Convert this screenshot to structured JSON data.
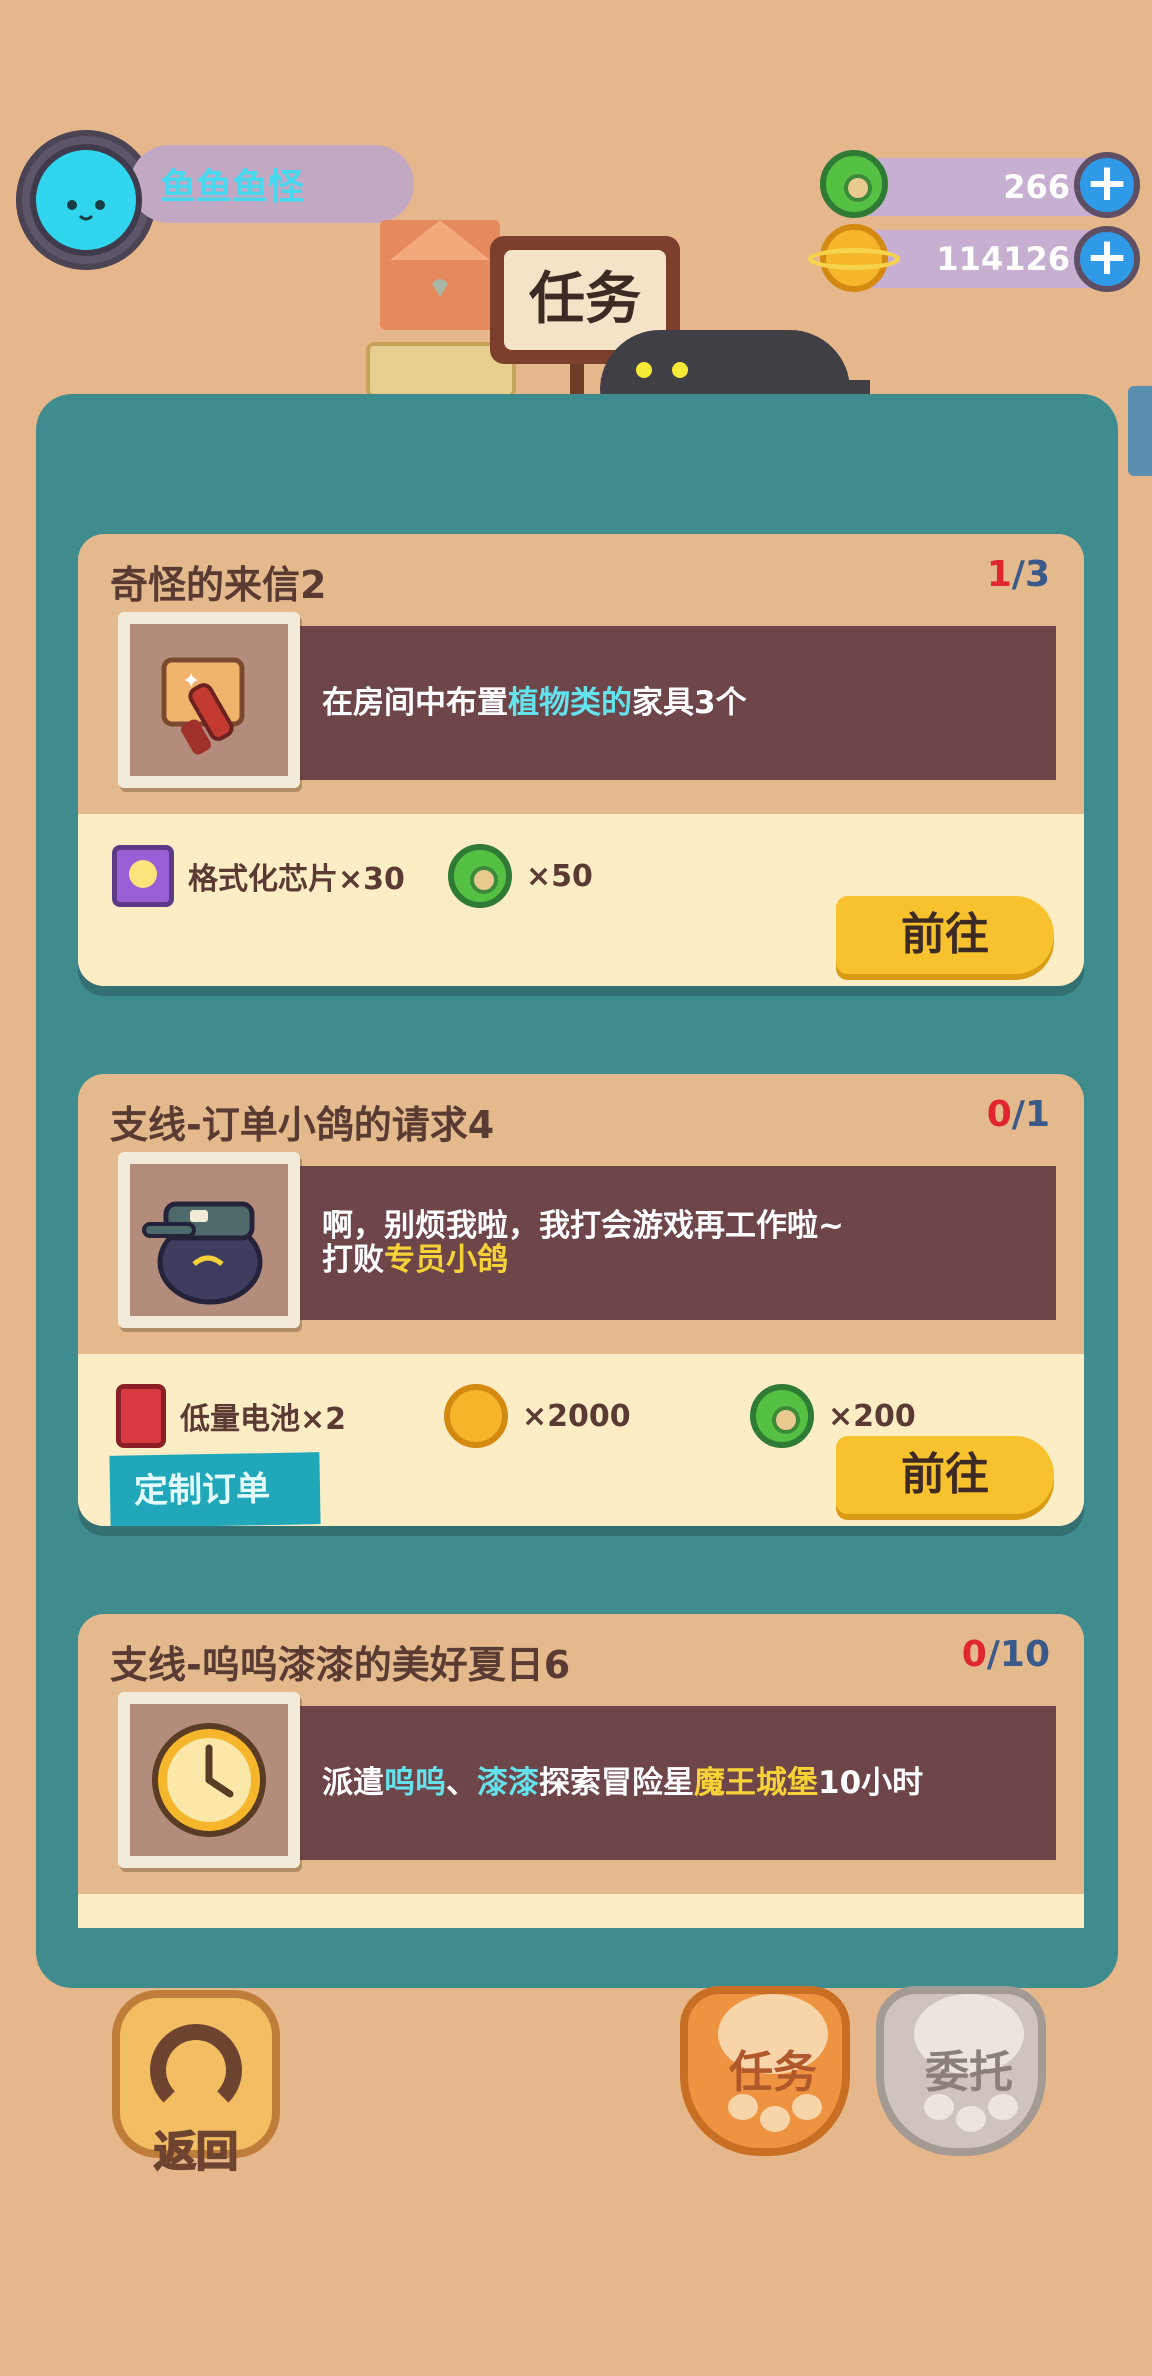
{
  "player": {
    "name": "鱼鱼鱼怪"
  },
  "resources": {
    "gems": {
      "value": "266",
      "icon": "green-gem-icon"
    },
    "coins": {
      "value": "114126",
      "icon": "gold-planet-coin-icon"
    }
  },
  "header": {
    "title": "任务"
  },
  "tasks": [
    {
      "title": "奇怪的来信2",
      "progress_done": "1",
      "progress_total": "/3",
      "desc_parts": [
        "在房间中布置",
        "植物类的",
        "家具3个"
      ],
      "icon": "paint-roller-icon",
      "rewards": [
        {
          "label": "格式化芯片×30",
          "icon": "chip-icon"
        },
        {
          "label": "×50",
          "icon": "gem-icon"
        }
      ],
      "button": "前往"
    },
    {
      "title": "支线-订单小鸽的请求4",
      "progress_done": "0",
      "progress_total": "/1",
      "desc_line1": "啊，别烦我啦，我打会游戏再工作啦~",
      "desc_line2_parts": [
        "打败",
        "专员小鸽"
      ],
      "icon": "pigeon-icon",
      "rewards": [
        {
          "label": "低量电池×2",
          "icon": "battery-icon"
        },
        {
          "label": "×2000",
          "icon": "coin-icon"
        },
        {
          "label": "×200",
          "icon": "gem-icon"
        }
      ],
      "tag": "定制订单",
      "button": "前往"
    },
    {
      "title": "支线-呜呜漆漆的美好夏日6",
      "progress_done": "0",
      "progress_total": "/10",
      "desc_parts": [
        "派遣",
        "呜呜",
        "、",
        "漆漆",
        "探索冒险星",
        "魔王城堡",
        "10小时"
      ],
      "icon": "clock-icon"
    }
  ],
  "bottom": {
    "back": "返回",
    "tab_tasks": "任务",
    "tab_commission": "委托"
  },
  "colors": {
    "background": "#e6b78a",
    "panel": "#3f8c8f",
    "card": "#e4b98b",
    "reward_band": "#fdedc5",
    "task_strip": "#6e4549",
    "button": "#f8c22e",
    "highlight_cyan": "#62e3ee",
    "highlight_yellow": "#f7d236",
    "progress_done": "#e0262f"
  }
}
